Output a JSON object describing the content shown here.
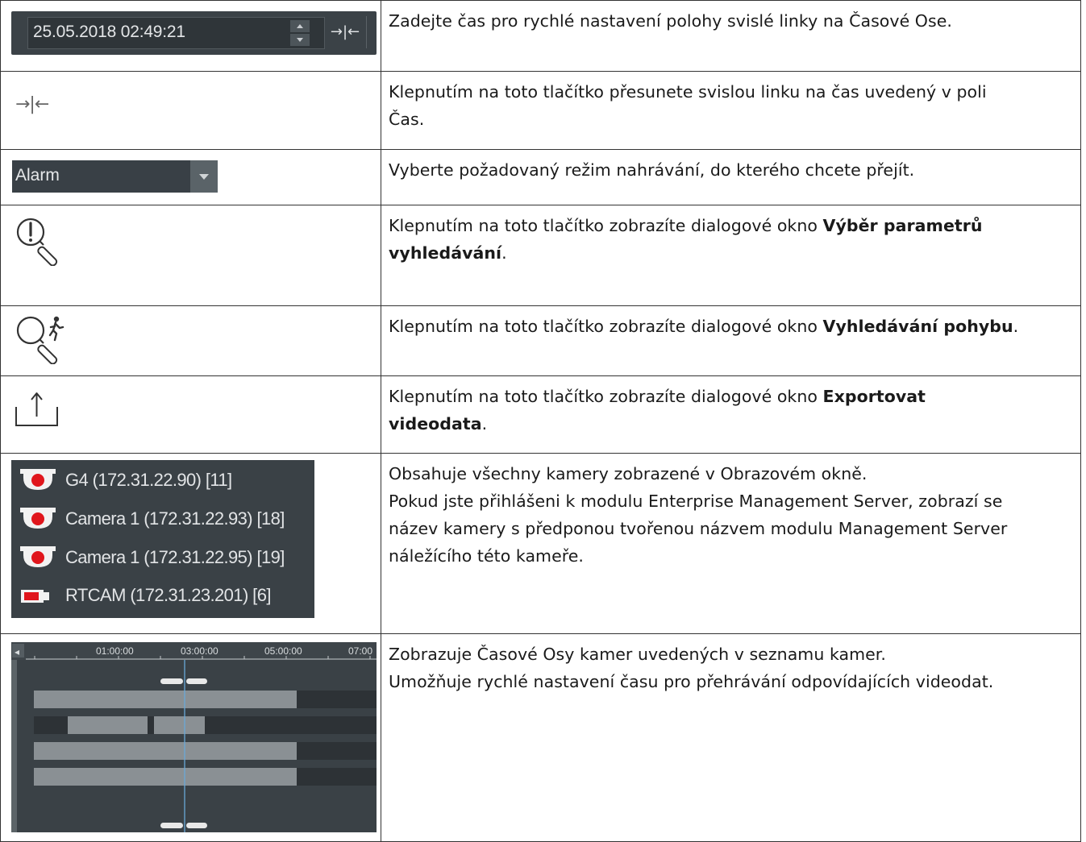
{
  "rows": [
    {
      "time_field": {
        "value": "25.05.2018 02:49:21",
        "go_glyph": "→|←"
      },
      "description": "Zadejte čas pro rychlé nastavení polohy svislé linky na Časové Ose."
    },
    {
      "icon": "go-to-time-icon",
      "go_glyph": "→|←",
      "description_lines": [
        "Klepnutím na toto tlačítko přesunete svislou linku na čas uvedený v poli",
        "Čas."
      ]
    },
    {
      "dropdown": {
        "value": "Alarm"
      },
      "description": "Vyberte požadovaný režim nahrávání, do kterého chcete přejít."
    },
    {
      "icon": "alarm-search-icon",
      "desc_prefix": "Klepnutím na toto tlačítko zobrazíte dialogové okno ",
      "desc_bold_line1": "Výběr parametrů",
      "desc_bold_line2": "vyhledávání",
      "desc_suffix": "."
    },
    {
      "icon": "motion-search-icon",
      "desc_prefix": "Klepnutím na toto tlačítko zobrazíte dialogové okno ",
      "desc_bold": "Vyhledávání pohybu",
      "desc_suffix": "."
    },
    {
      "icon": "export-icon",
      "desc_prefix": "Klepnutím na toto tlačítko zobrazíte dialogové okno ",
      "desc_bold_line1": "Exportovat",
      "desc_bold_line2": "videodata",
      "desc_suffix": "."
    },
    {
      "camera_list": [
        {
          "label": "G4 (172.31.22.90) [11]",
          "icon": "dome-camera-icon"
        },
        {
          "label": "Camera 1 (172.31.22.93) [18]",
          "icon": "dome-camera-icon"
        },
        {
          "label": "Camera 1 (172.31.22.95) [19]",
          "icon": "dome-camera-icon"
        },
        {
          "label": "RTCAM (172.31.23.201) [6]",
          "icon": "box-camera-icon"
        }
      ],
      "description_lines": [
        "Obsahuje všechny kamery zobrazené v Obrazovém okně.",
        "Pokud jste přihlášeni k modulu Enterprise Management Server, zobrazí se",
        "název kamery s předponou tvořenou názvem modulu Management Server",
        "náležícího této kameře."
      ]
    },
    {
      "timeline": {
        "ticks": [
          "01:00:00",
          "03:00:00",
          "05:00:00",
          "07:00"
        ],
        "scroll_left_glyph": "◂"
      },
      "description_lines": [
        "Zobrazuje Časové Osy kamer uvedených v seznamu kamer.",
        "Umožňuje rychlé nastavení času pro přehrávání odpovídajících videodat."
      ]
    }
  ],
  "colors": {
    "panel_dark": "#3a4146",
    "camera_red": "#e0161c",
    "timeline_bar": "#8a9094",
    "playhead": "#6aa9d8"
  }
}
